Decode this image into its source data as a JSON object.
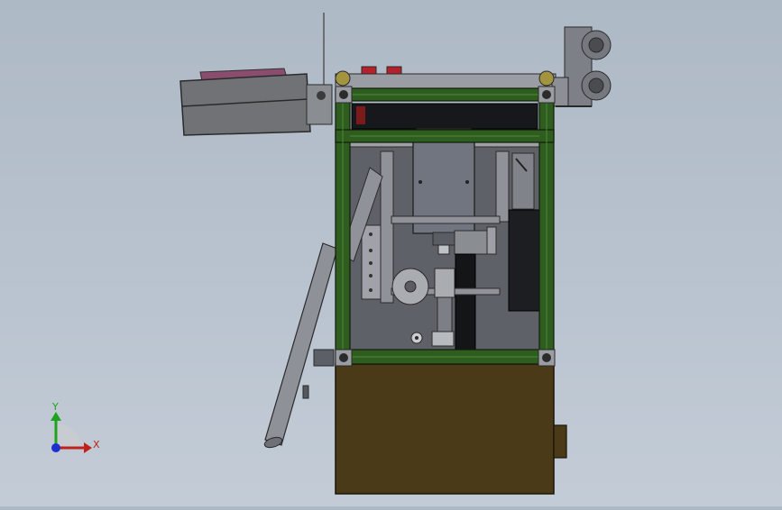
{
  "viewport": {
    "description_colors": {
      "background_top": "#aeb9c6",
      "background_bottom": "#c3ccd6",
      "frame_green": "#2f5d1f",
      "base_brown": "#4a3a17",
      "panel_gray": "#6b6f76"
    }
  },
  "triad": {
    "y_label": "Y",
    "x_label": "X",
    "y_color": "#1fa31f",
    "x_color": "#c0211a",
    "z_color": "#1c2fd0"
  }
}
